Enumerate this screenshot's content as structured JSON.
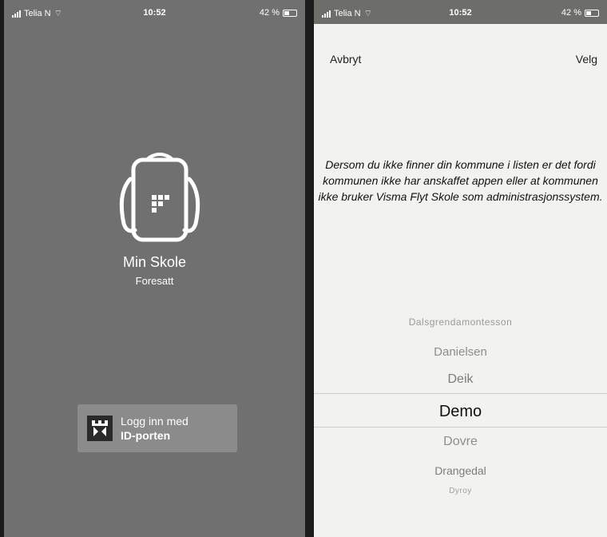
{
  "left_screen": {
    "status": {
      "carrier": "Telia N",
      "time": "10:52",
      "battery": "42 %",
      "battery_level": 0.42
    },
    "app": {
      "name": "Min Skole",
      "subtitle": "Foresatt"
    },
    "login": {
      "line1": "Logg inn med",
      "line2": "ID-porten"
    }
  },
  "right_screen": {
    "status": {
      "carrier": "Telia N",
      "time": "10:52",
      "battery": "42 %",
      "battery_level": 0.42
    },
    "nav": {
      "cancel": "Avbryt",
      "choose": "Velg"
    },
    "info_text": "Dersom du ikke finner din kommune i listen er det fordi kommunen ikke har anskaffet appen eller at kommunen ikke bruker Visma Flyt Skole som administrasjonssystem.",
    "picker": {
      "items": [
        "Dalsgrendamontesson",
        "Danielsen",
        "Deik",
        "Demo",
        "Dovre",
        "Drangedal",
        "Dyroy"
      ],
      "selected": "Demo"
    }
  },
  "colors": {
    "left_bg": "#707070",
    "right_bg": "#f2f2f0",
    "button_bg": "#8b8b8b"
  }
}
